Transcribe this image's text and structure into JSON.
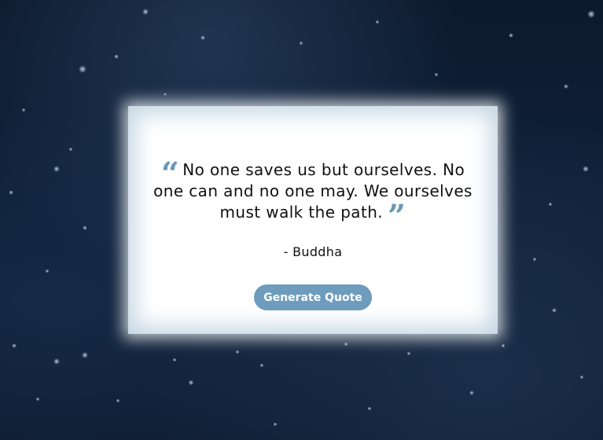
{
  "colors": {
    "background": "#0f2038",
    "card": "#ffffff",
    "accent": "#6a98b9",
    "button": "#6e9cbc"
  },
  "quote": {
    "text": "No one saves us but ourselves. No one can and no one may. We ourselves must walk the path.",
    "author": "- Buddha",
    "open_icon": "open-quote-icon",
    "close_icon": "close-quote-icon"
  },
  "button": {
    "label": "Generate Quote"
  }
}
